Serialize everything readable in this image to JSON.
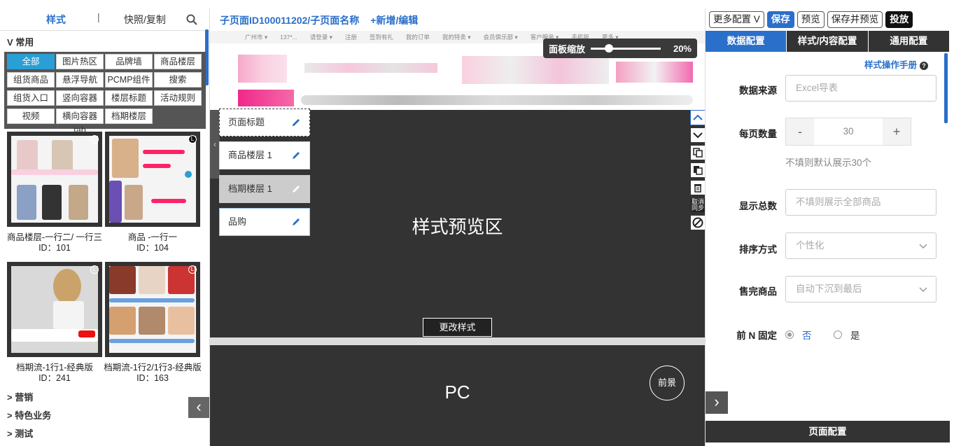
{
  "left_panel": {
    "tab_style": "样式",
    "tab_separator": "|",
    "tab_snapshot": "快照/复制",
    "category_common": "V  常用",
    "grid_buttons": [
      "全部",
      "图片热区",
      "品牌墙",
      "商品楼层",
      "组货商品",
      "悬浮导航",
      "PCMP组件",
      "搜索",
      "组货入口",
      "竖向容器tab",
      "楼层标题",
      "活动规则",
      "视频",
      "横向容器tab",
      "档期楼层"
    ],
    "thumbnails": [
      {
        "name": "商品楼层-一行二/ 一行三",
        "id": "ID：101"
      },
      {
        "name": "商品 -一行一",
        "id": "ID：104"
      },
      {
        "name": "档期流-1行1-经典版",
        "id": "ID：241"
      },
      {
        "name": "档期流-1行2/1行3-经典版",
        "id": "ID：163"
      }
    ],
    "more_categories": [
      ">  营销",
      ">  特色业务",
      ">  测试"
    ],
    "collapse_arrow": "‹"
  },
  "center": {
    "header_title": "子页面ID100011202/子页面名称",
    "header_add": "+新增/编辑",
    "navbar_items": [
      "广州市 ▾",
      "137*...",
      "请登录 ▾",
      "注册",
      "签到有礼",
      "我的订单",
      "我的特卖 ▾",
      "会员俱乐部 ▾",
      "客户服务 ▾",
      "手机版",
      "更多 ▾"
    ],
    "zoom_label": "面板缩放",
    "zoom_value": "20%",
    "zoom_level": 0.2,
    "layers": [
      "页面标题",
      "商品楼层 1",
      "档期楼层 1",
      "品购"
    ],
    "preview_label": "样式预览区",
    "change_style": "更改样式",
    "pc_label": "PC",
    "foreground": "前景",
    "tool_cancel_sync": "取消同步",
    "left_handle": "‹"
  },
  "right_panel": {
    "more_config": "更多配置  V",
    "save": "保存",
    "preview": "预览",
    "save_preview": "保存并预览",
    "publish": "投放",
    "tabs": [
      "数据配置",
      "样式/内容配置",
      "通用配置"
    ],
    "manual": "样式操作手册",
    "manual_icon": "?",
    "fields": {
      "data_source_label": "数据来源",
      "data_source_placeholder": "Excel导表",
      "per_page_label": "每页数量",
      "per_page_minus": "-",
      "per_page_value": "30",
      "per_page_plus": "+",
      "per_page_hint": "不填则默认展示30个",
      "total_label": "显示总数",
      "total_placeholder": "不填则展示全部商品",
      "sort_label": "排序方式",
      "sort_value": "个性化",
      "soldout_label": "售完商品",
      "soldout_value": "自动下沉到最后",
      "fixed_label": "前 N 固定",
      "fixed_no": "否",
      "fixed_yes": "是"
    },
    "expand_arrow": "›",
    "footer": "页面配置"
  }
}
